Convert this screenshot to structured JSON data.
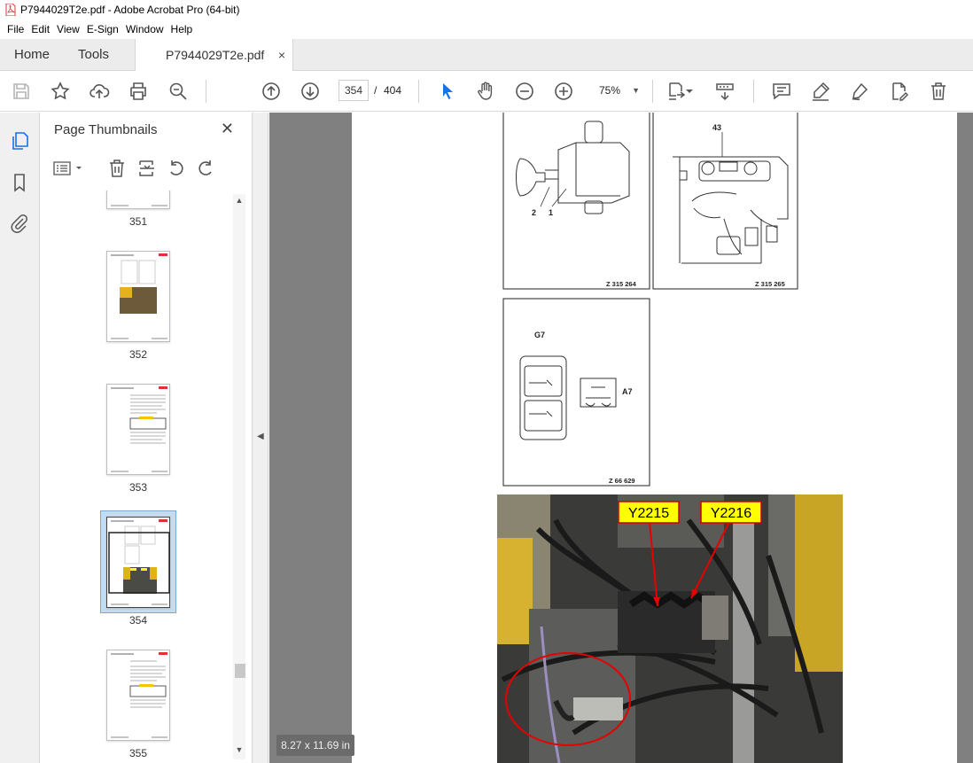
{
  "window": {
    "title": "P7944029T2e.pdf - Adobe Acrobat Pro (64-bit)"
  },
  "menu": [
    "File",
    "Edit",
    "View",
    "E-Sign",
    "Window",
    "Help"
  ],
  "tabs": {
    "home": "Home",
    "tools": "Tools",
    "document": "P7944029T2e.pdf",
    "close": "×"
  },
  "toolbar": {
    "current_page": "354",
    "page_separator": "/",
    "total_pages": "404",
    "zoom": "75%"
  },
  "thumbnails_panel": {
    "title": "Page Thumbnails",
    "close": "✕",
    "pages": [
      "351",
      "352",
      "353",
      "354",
      "355"
    ],
    "selected_page": "354"
  },
  "document": {
    "page_size": "8.27 x 11.69 in",
    "figures": {
      "fig1": {
        "label_2": "2",
        "label_1": "1",
        "code": "Z 315 264"
      },
      "fig2": {
        "label": "43",
        "code": "Z 315 265"
      },
      "fig3": {
        "label_g7": "G7",
        "label_a7": "A7",
        "code": "Z 66 629"
      },
      "photo": {
        "callout_1": "Y2215",
        "callout_2": "Y2216"
      }
    }
  },
  "colors": {
    "accent": "#1473e6",
    "callout_fill": "#ffff00",
    "callout_border": "#cc0000",
    "annotation_red": "#e60000"
  }
}
